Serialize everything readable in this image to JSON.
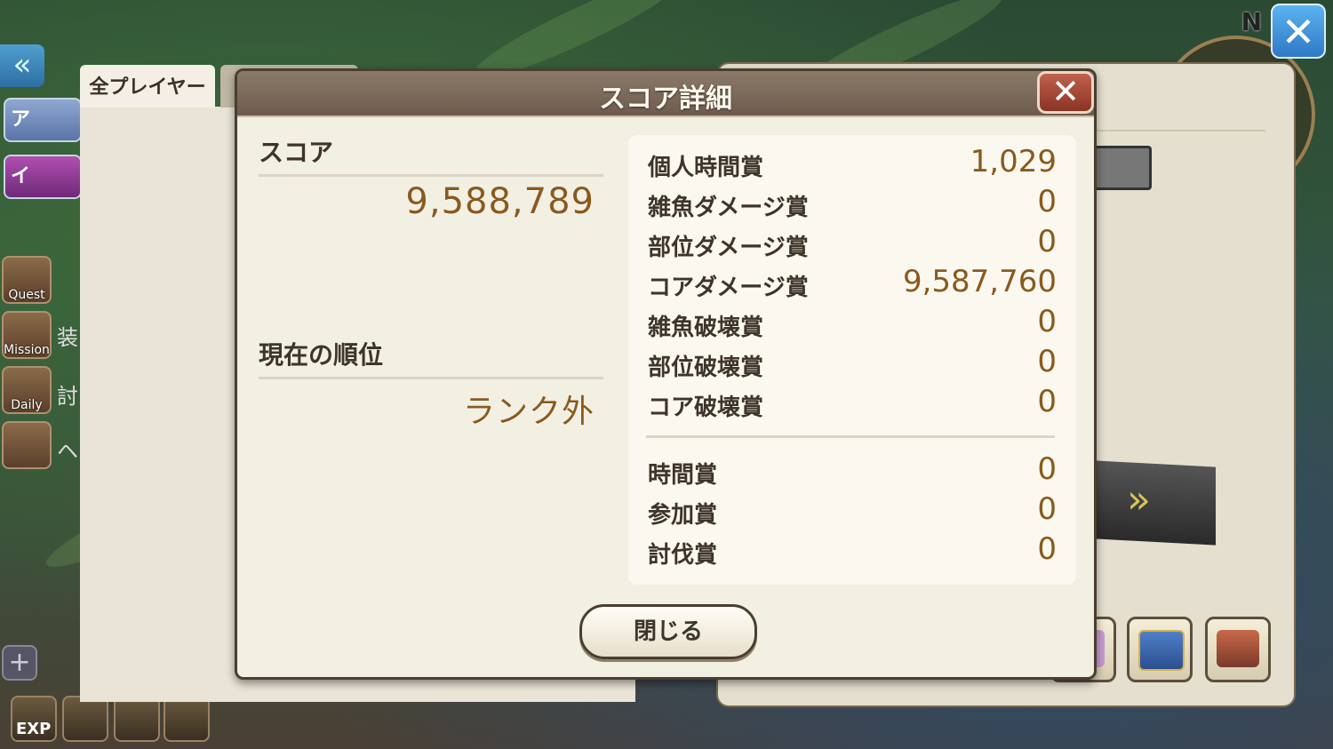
{
  "background": {
    "compass_label": "N",
    "side_labels": [
      "Quest",
      "Mission",
      "Daily"
    ],
    "side_texts": [
      "装",
      "討",
      "ヘ"
    ],
    "rail_buttons": [
      "ア",
      "イ"
    ],
    "exp_label": "EXP"
  },
  "tabs": {
    "all_players": "全プレイヤー"
  },
  "modal": {
    "title": "スコア詳細",
    "close_icon": "✕",
    "score_label": "スコア",
    "score_value": "9,588,789",
    "rank_label": "現在の順位",
    "rank_value": "ランク外",
    "breakdown": [
      {
        "label": "個人時間賞",
        "value": "1,029"
      },
      {
        "label": "雑魚ダメージ賞",
        "value": "0"
      },
      {
        "label": "部位ダメージ賞",
        "value": "0"
      },
      {
        "label": "コアダメージ賞",
        "value": "9,587,760"
      },
      {
        "label": "雑魚破壊賞",
        "value": "0"
      },
      {
        "label": "部位破壊賞",
        "value": "0"
      },
      {
        "label": "コア破壊賞",
        "value": "0"
      }
    ],
    "bonus": [
      {
        "label": "時間賞",
        "value": "0"
      },
      {
        "label": "参加賞",
        "value": "0"
      },
      {
        "label": "討伐賞",
        "value": "0"
      }
    ],
    "close_button": "閉じる"
  },
  "colors": {
    "value_brown": "#8a5a1c",
    "header_brown": "#7b6a5a",
    "close_red": "#a8452f"
  }
}
